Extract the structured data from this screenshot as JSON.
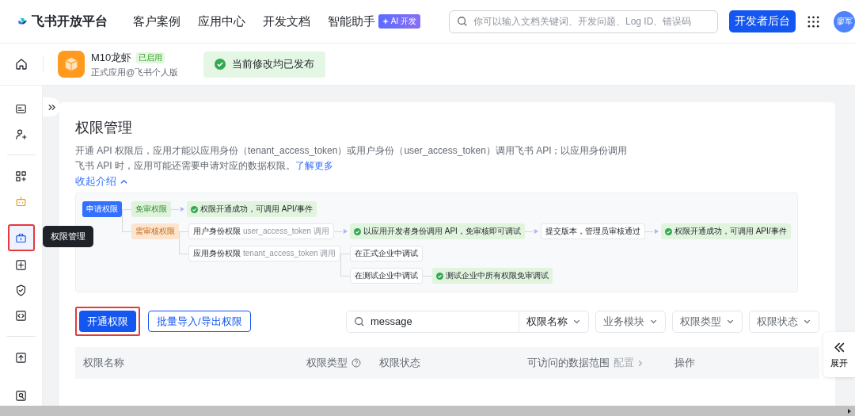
{
  "nav": {
    "logo": "飞书开放平台",
    "links": [
      {
        "label": "客户案例"
      },
      {
        "label": "应用中心"
      },
      {
        "label": "开发文档"
      },
      {
        "label": "智能助手",
        "badge": "AI 开发"
      }
    ],
    "search": {
      "placeholder": "你可以输入文档关键词、开发问题、Log ID、错误码"
    },
    "console_button": "开发者后台",
    "avatar": "廖军"
  },
  "app": {
    "name": "M10龙虾",
    "status": "已启用",
    "subtitle": "正式应用@飞书个人版",
    "notice": "当前修改均已发布"
  },
  "sidebar": {
    "tooltip": "权限管理",
    "groups": [
      {
        "items": [
          {
            "selected": false,
            "annotated": false
          },
          {
            "selected": false,
            "annotated": false
          }
        ]
      },
      {
        "items": [
          {
            "selected": false,
            "annotated": false
          },
          {
            "selected": false,
            "annotated": false
          },
          {
            "selected": true,
            "annotated": true
          },
          {
            "selected": false,
            "annotated": false
          },
          {
            "selected": false,
            "annotated": false
          },
          {
            "selected": false,
            "annotated": false
          }
        ]
      },
      {
        "items": [
          {
            "selected": false,
            "annotated": false
          },
          {
            "selected": false,
            "annotated": false
          }
        ]
      }
    ]
  },
  "page": {
    "title": "权限管理",
    "description": "开通 API 权限后，应用才能以应用身份（tenant_access_token）或用户身份（user_access_token）调用飞书 API；以应用身份调用飞书 API 时，应用可能还需要申请对应的数据权限。",
    "learn_more": "了解更多",
    "collapse": "收起介绍"
  },
  "diagram": {
    "root": {
      "text": "申请权限",
      "kind": "start",
      "children": [
        {
          "text": "免审权限",
          "kind": "free",
          "children": [
            {
              "text": "权限开通成功，可调用 API/事件",
              "kind": "success",
              "arrow": true
            }
          ]
        },
        {
          "text": "需审核权限",
          "kind": "review",
          "children": [
            {
              "text": "用户身份权限",
              "note": "user_access_token 调用",
              "kind": "plain",
              "children": [
                {
                  "text": "以应用开发者身份调用 API，免审核即可调试",
                  "kind": "success",
                  "arrow": true,
                  "children": [
                    {
                      "text": "提交版本，管理员审核通过",
                      "kind": "plain",
                      "arrow": true,
                      "children": [
                        {
                          "text": "权限开通成功，可调用 API/事件",
                          "kind": "success",
                          "arrow": true
                        }
                      ]
                    }
                  ]
                }
              ]
            },
            {
              "text": "应用身份权限",
              "note": "tenant_access_token 调用",
              "kind": "plain",
              "children": [
                {
                  "text": "在正式企业中调试",
                  "kind": "plain"
                },
                {
                  "text": "在测试企业中调试",
                  "kind": "plain",
                  "children": [
                    {
                      "text": "测试企业中所有权限免审调试",
                      "kind": "success"
                    }
                  ]
                }
              ]
            }
          ]
        }
      ]
    }
  },
  "actions": [
    {
      "label": "开通权限",
      "kind": "primary",
      "annotated": true
    },
    {
      "label": "批量导入/导出权限",
      "kind": "outline",
      "annotated": false
    }
  ],
  "filters": {
    "search": {
      "value": "message",
      "scope": "权限名称"
    },
    "selects": [
      "业务模块",
      "权限类型",
      "权限状态"
    ]
  },
  "table": {
    "columns": [
      {
        "label": "权限名称",
        "help": false
      },
      {
        "label": "权限类型",
        "help": true
      },
      {
        "label": "权限状态",
        "help": false
      },
      {
        "label": "可访问的数据范围",
        "help": false,
        "link": "配置"
      },
      {
        "label": "操作",
        "help": false
      }
    ]
  },
  "expand_button": "展开"
}
